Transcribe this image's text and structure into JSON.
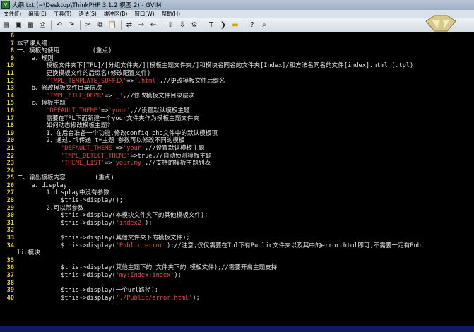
{
  "window": {
    "title": "大纲.txt (~\\Desktop\\ThinkPHP 3.1.2 视图 2) - GVIM"
  },
  "menu": [
    "文件(F)",
    "编辑(E)",
    "工具(T)",
    "语法(S)",
    "缓冲区(B)",
    "窗口(W)",
    "帮助(H)"
  ],
  "toolbar_icons": [
    "open-icon",
    "save-icon",
    "save-all-icon",
    "print-icon",
    "undo-icon",
    "redo-icon",
    "cut-icon",
    "copy-icon",
    "paste-icon",
    "find-replace-icon",
    "find-next-icon",
    "find-prev-icon",
    "load-session-icon",
    "save-session-icon",
    "run-script-icon",
    "make-icon",
    "shell-icon",
    "make-tags-icon",
    "jump-tag-icon",
    "help-icon",
    "find-help-icon"
  ],
  "editor": {
    "lines": [
      {
        "n": "6",
        "t": ""
      },
      {
        "n": "7",
        "t": "本节课大纲:"
      },
      {
        "n": "8",
        "t": "一、模板的使用         (重点)"
      },
      {
        "n": "9",
        "t": "    a、规则"
      },
      {
        "n": "10",
        "t": "        模板文件夹下[TPL]/[分组文件夹/][模板主题文件夹/]和模块名同名的文件夹[Index]/和方法名同名的文件[index].html (.tpl)"
      },
      {
        "n": "11",
        "t": "        更换模板文件的后缀名(修改配置文件)"
      },
      {
        "n": "12",
        "t": "        'TMPL_TEMPLATE_SUFFIX'=>'.html',//更改模板文件后缀名"
      },
      {
        "n": "13",
        "t": "    b、修改模板文件目录层次"
      },
      {
        "n": "14",
        "t": "        'TMPL_FILE_DEPR'=>'_',//修改模板文件目录层次"
      },
      {
        "n": "15",
        "t": "    c、模板主题"
      },
      {
        "n": "16",
        "t": "        'DEFAULT_THEME'=>'your',//设置默认模板主题"
      },
      {
        "n": "17",
        "t": "        需要在TPL下面新建一个your文件夹作为模板主题文件夹"
      },
      {
        "n": "18",
        "t": "        如何动态修改模板主题?"
      },
      {
        "n": "19",
        "t": "        1、在后台准备一个功能,修改config.php文件中的默认模板项"
      },
      {
        "n": "20",
        "t": "        2、通过url传递 t=主题 参数可以修改不同的模板"
      },
      {
        "n": "21",
        "t": "            'DEFAULT_THEME'=>'your',//设置默认模板主题"
      },
      {
        "n": "22",
        "t": "            'TMPL_DETECT_THEME'=>true,//自动侦测模板主题"
      },
      {
        "n": "23",
        "t": "            'THEME_LIST'=>'your,my',//支持的模板主题列表"
      },
      {
        "n": "24",
        "t": ""
      },
      {
        "n": "25",
        "t": "二、输出模板内容        (重点)"
      },
      {
        "n": "26",
        "t": "    a、display"
      },
      {
        "n": "27",
        "t": "        1.display中没有参数"
      },
      {
        "n": "28",
        "t": "            $this->display();"
      },
      {
        "n": "29",
        "t": "        2.可以带参数"
      },
      {
        "n": "30",
        "t": "            $this->display(本模块文件夹下的其他模板文件);"
      },
      {
        "n": "31",
        "t": "            $this->display('index2');"
      },
      {
        "n": "32",
        "t": ""
      },
      {
        "n": "33",
        "t": "            $this->display(其他文件夹下的模板文件);"
      },
      {
        "n": "34",
        "t": "            $this->display('Public:error');//注意,仅仅需要在Tpl下有Public文件夹以及其中的error.html即可,不需要一定有Pub"
      },
      {
        "n": "",
        "t": "lic模块"
      },
      {
        "n": "35",
        "t": ""
      },
      {
        "n": "36",
        "t": "            $this->display(其他主题下的 文件夹下的 模板文件);//需要开启主题支持"
      },
      {
        "n": "37",
        "t": "            $this->display('my:Index:index');"
      },
      {
        "n": "38",
        "t": ""
      },
      {
        "n": "39",
        "t": "            $this->display(一个url路径);"
      },
      {
        "n": "40",
        "t": "            $this->display('./Public/error.html');"
      }
    ]
  }
}
